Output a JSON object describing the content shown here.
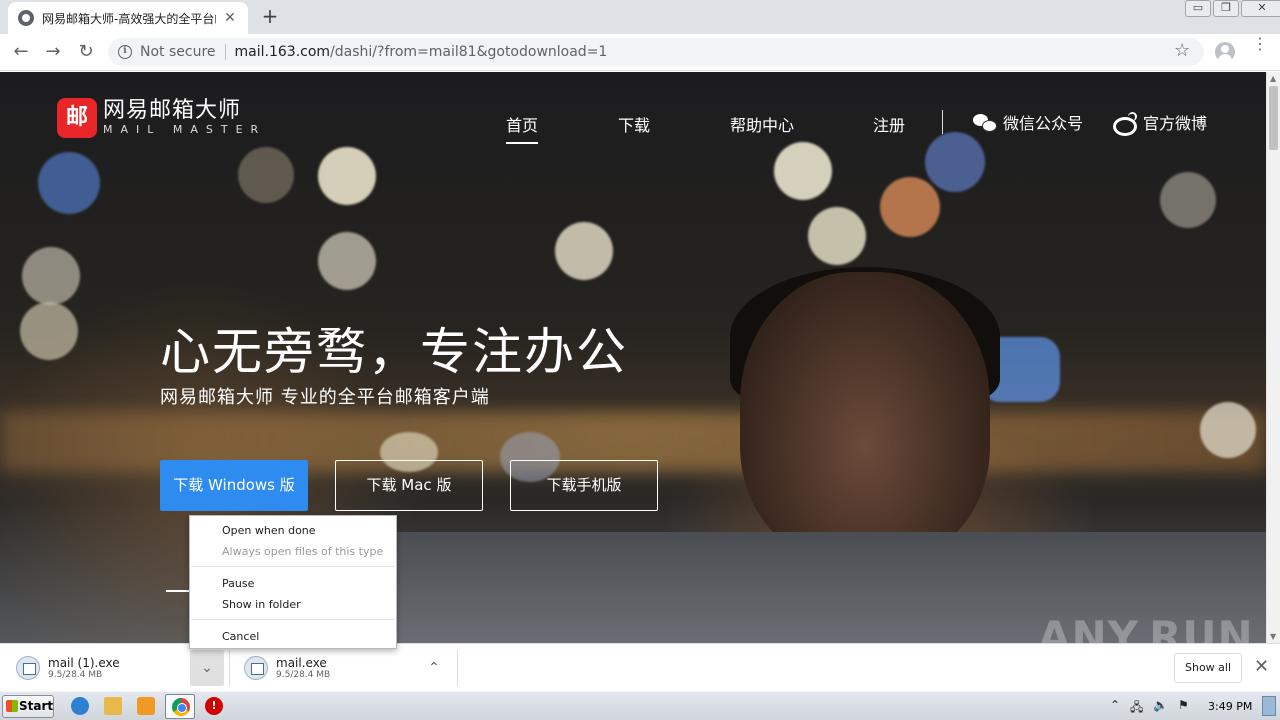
{
  "browser": {
    "tab_title": "网易邮箱大师-高效强大的全平台邮箱客户端",
    "tab_close": "✕",
    "new_tab": "+",
    "url_security": "Not secure",
    "url_host": "mail.163.com",
    "url_path": "/dashi/?from=mail81&gotodownload=1",
    "window_controls": {
      "minimize": "▭",
      "restore": "❐",
      "close": "✕"
    }
  },
  "site": {
    "logo_mark": "邮",
    "logo_cn": "网易邮箱大师",
    "logo_en": "MAIL MASTER",
    "nav": [
      "首页",
      "下载",
      "帮助中心",
      "注册"
    ],
    "social": {
      "wechat": "微信公众号",
      "weibo": "官方微博"
    },
    "hero_title": "心无旁骛，专注办公",
    "hero_subtitle": "网易邮箱大师   专业的全平台邮箱客户端",
    "buttons": {
      "windows": "下载 Windows 版",
      "mac": "下载 Mac 版",
      "mobile": "下载手机版"
    },
    "watermark": "ANY.RUN"
  },
  "context_menu": {
    "open_when_done": "Open when done",
    "always_open": "Always open files of this type",
    "pause": "Pause",
    "show_in_folder": "Show in folder",
    "cancel": "Cancel"
  },
  "downloads": {
    "items": [
      {
        "name": "mail (1).exe",
        "size": "9.5/28.4 MB"
      },
      {
        "name": "mail.exe",
        "size": "9.5/28.4 MB"
      }
    ],
    "show_all": "Show all",
    "close": "✕"
  },
  "taskbar": {
    "start": "Start",
    "clock": "3:49 PM"
  }
}
